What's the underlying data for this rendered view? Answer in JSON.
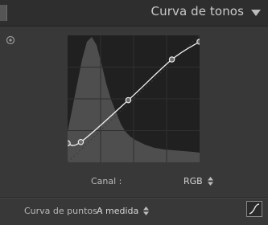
{
  "header": {
    "title": "Curva de tonos",
    "collapse_icon": "triangle-down-icon"
  },
  "tools": {
    "target_icon": "target-adjustment-icon"
  },
  "channel": {
    "label": "Canal :",
    "value": "RGB"
  },
  "point_curve": {
    "label": "Curva de puntos :",
    "value": "A medida",
    "edit_icon": "point-curve-edit-icon"
  },
  "curve_points": [
    {
      "input": 0,
      "output": 15
    },
    {
      "input": 10,
      "output": 16
    },
    {
      "input": 46,
      "output": 49
    },
    {
      "input": 79,
      "output": 81
    },
    {
      "input": 100,
      "output": 95
    }
  ],
  "colors": {
    "panel_bg": "#383838",
    "header_bg": "#2e2e2e",
    "graph_bg": "#202020",
    "histogram": "#505050",
    "curve": "#f2f2f2"
  }
}
